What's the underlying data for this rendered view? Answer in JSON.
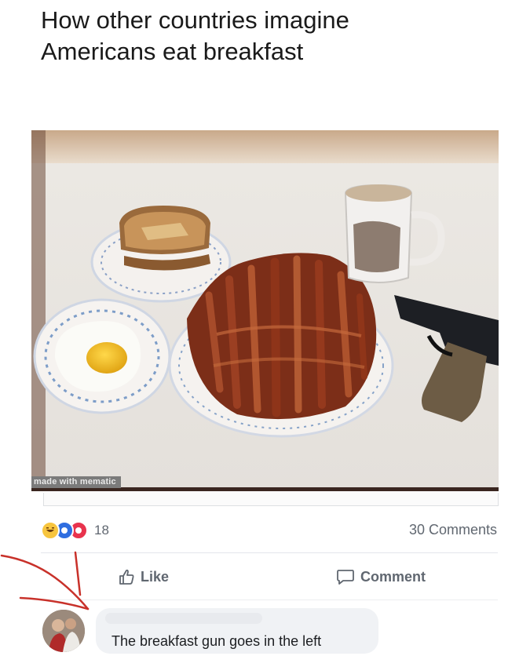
{
  "caption": {
    "line1": "How other countries imagine",
    "line2": "Americans eat breakfast"
  },
  "photo": {
    "watermark": "made with mematic"
  },
  "reactions": {
    "icons": [
      "haha-icon",
      "wow-icon",
      "wow-icon"
    ],
    "count": "18"
  },
  "comments_count": "30 Comments",
  "actions": {
    "like_label": "Like",
    "comment_label": "Comment"
  },
  "comment": {
    "text": "The breakfast gun goes in the left"
  },
  "colors": {
    "annotation_arrow": "#c8312a",
    "action_text": "#606770"
  }
}
